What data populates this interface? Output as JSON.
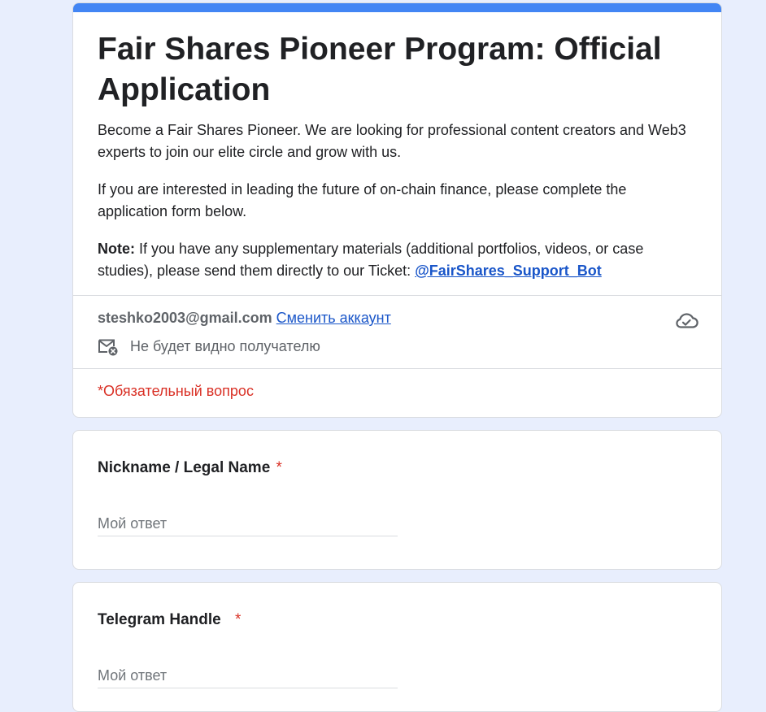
{
  "form": {
    "title": "Fair Shares Pioneer Program: Official Application",
    "description_1": "Become a Fair Shares Pioneer. We are looking for professional content creators and Web3 experts to join our elite circle and grow with us.",
    "description_2": "If you are interested in leading the future of on-chain finance, please complete the application form below.",
    "note_label": "Note:",
    "note_text": " If you have any supplementary materials (additional portfolios, videos, or case studies), please send them directly to our Ticket: ",
    "note_link": "@FairShares_Support_Bot",
    "accent_color": "#4285f4"
  },
  "account": {
    "email": "steshko2003@gmail.com",
    "switch_label": "Сменить аккаунт",
    "privacy_text": "Не будет видно получателю",
    "cloud_icon": "cloud-check-icon",
    "mail_icon": "mail-off-icon"
  },
  "required_note": "*Обязательный вопрос",
  "questions": [
    {
      "title": "Nickname / Legal Name",
      "required_mark": "*",
      "placeholder": "Мой ответ",
      "value": ""
    },
    {
      "title": "Telegram Handle",
      "required_mark": "*",
      "placeholder": "Мой ответ",
      "value": ""
    }
  ]
}
